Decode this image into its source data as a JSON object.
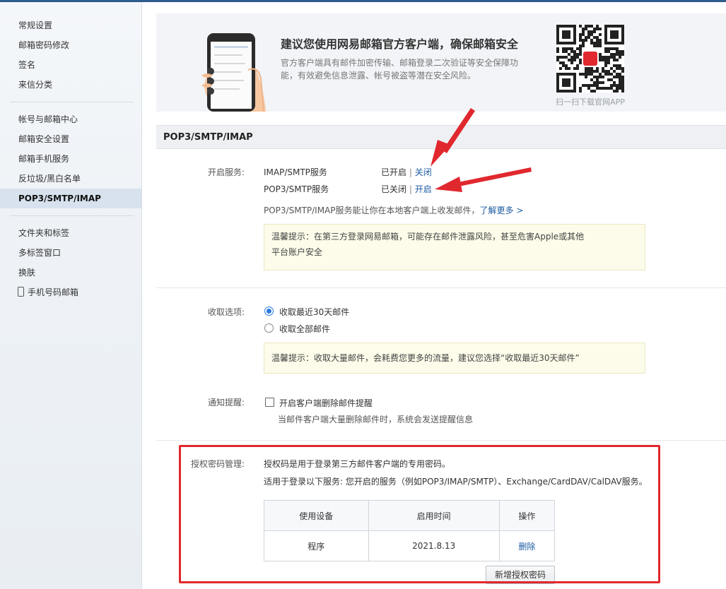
{
  "sidebar": {
    "group1": [
      "常规设置",
      "邮箱密码修改",
      "签名",
      "来信分类"
    ],
    "group2": [
      "帐号与邮箱中心",
      "邮箱安全设置",
      "邮箱手机服务",
      "反垃圾/黑白名单",
      "POP3/SMTP/IMAP"
    ],
    "group3": [
      "文件夹和标签",
      "多标签窗口",
      "换肤",
      "手机号码邮箱"
    ],
    "active": "POP3/SMTP/IMAP"
  },
  "banner": {
    "title": "建议您使用网易邮箱官方客户端，确保邮箱安全",
    "text": "官方客户端具有邮件加密传输、邮箱登录二次验证等安全保障功能，有效避免信息泄露、帐号被盗等潜在安全风险。",
    "qr_caption": "扫一扫下载官网APP"
  },
  "section_title": "POP3/SMTP/IMAP",
  "services": {
    "label": "开启服务:",
    "items": [
      {
        "name": "IMAP/SMTP服务",
        "status": "已开启",
        "action": "关闭"
      },
      {
        "name": "POP3/SMTP服务",
        "status": "已关闭",
        "action": "开启"
      }
    ],
    "desc": "POP3/SMTP/IMAP服务能让你在本地客户端上收发邮件，",
    "learn_more": "了解更多 >",
    "tip": "温馨提示：在第三方登录网易邮箱，可能存在邮件泄露风险，甚至危害Apple或其他平台账户安全"
  },
  "fetch": {
    "label": "收取选项:",
    "options": [
      "收取最近30天邮件",
      "收取全部邮件"
    ],
    "selected": 0,
    "tip": "温馨提示：收取大量邮件，会耗费您更多的流量，建议您选择“收取最近30天邮件”"
  },
  "notify": {
    "label": "通知提醒:",
    "checkbox_label": "开启客户端删除邮件提醒",
    "checked": false,
    "sub": "当邮件客户端大量删除邮件时，系统会发送提醒信息"
  },
  "auth": {
    "label": "授权密码管理:",
    "line1": "授权码是用于登录第三方邮件客户端的专用密码。",
    "line2": "适用于登录以下服务: 您开启的服务（例如POP3/IMAP/SMTP）、Exchange/CardDAV/CalDAV服务。",
    "columns": [
      "使用设备",
      "启用时间",
      "操作"
    ],
    "rows": [
      {
        "device": "程序",
        "time": "2021.8.13",
        "action": "删除"
      }
    ],
    "new_button": "新增授权密码"
  },
  "colors": {
    "link": "#1d5ba4",
    "annotation": "#e0282e",
    "active_nav": "#d7e2ee",
    "tip_bg": "#fdfbe9"
  }
}
